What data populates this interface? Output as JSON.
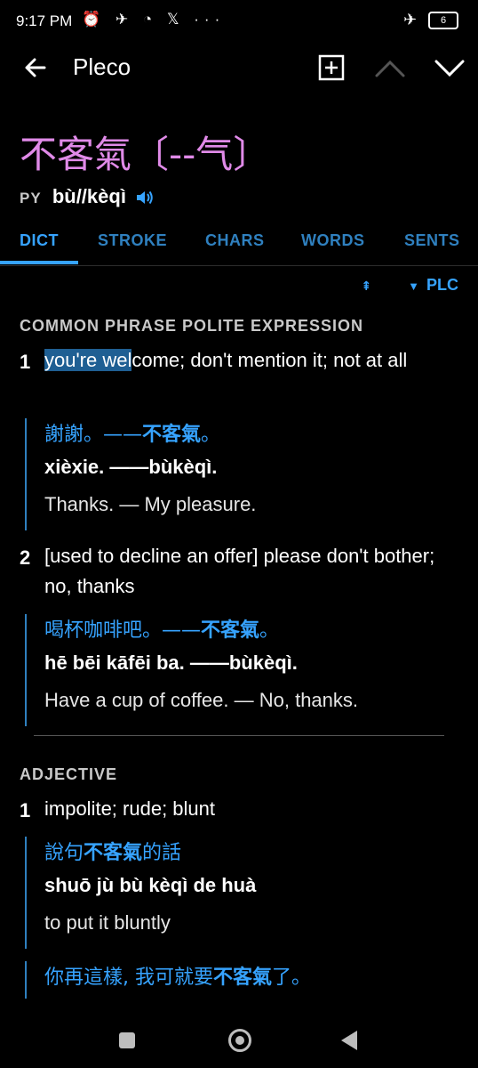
{
  "status": {
    "time": "9:17 PM",
    "icons": "⏰ ✈ ◔ 𝕏 ···",
    "battery": "6"
  },
  "appbar": {
    "title": "Pleco"
  },
  "entry": {
    "headword": "不客氣〔--气〕",
    "py_label": "PY",
    "reading": "bù//kèqì"
  },
  "tabs": [
    {
      "label": "DICT"
    },
    {
      "label": "STROKE"
    },
    {
      "label": "CHARS"
    },
    {
      "label": "WORDS"
    },
    {
      "label": "SENTS"
    }
  ],
  "dict_source": "PLC",
  "sections": {
    "s1_header": "COMMON PHRASE POLITE EXPRESSION",
    "d1_num": "1",
    "d1_hl": "you're wel",
    "d1_rest": "come; don't mention it; not at all",
    "ex1_cn_pre": "謝謝。——",
    "ex1_cn_bold": "不客氣",
    "ex1_cn_post": "。",
    "ex1_py": "xièxie. ——bùkèqì.",
    "ex1_en": "Thanks. — My pleasure.",
    "d2_num": "2",
    "d2_text": "[used to decline an offer] please don't bother; no, thanks",
    "ex2_cn_pre": "喝杯咖啡吧。——",
    "ex2_cn_bold": "不客氣",
    "ex2_cn_post": "。",
    "ex2_py": "hē bēi kāfēi ba. ——bùkèqì.",
    "ex2_en": "Have a cup of coffee. — No, thanks.",
    "s2_header": "ADJECTIVE",
    "d3_num": "1",
    "d3_text": "impolite; rude; blunt",
    "ex3_cn_pre": "說句",
    "ex3_cn_bold": "不客氣",
    "ex3_cn_post": "的話",
    "ex3_py_pre": "shuō jù ",
    "ex3_py_bold": "bù kèqì",
    "ex3_py_post": " de huà",
    "ex3_en": "to put it bluntly",
    "ex4_cn_pre": "你再這樣, 我可就要",
    "ex4_cn_bold": "不客氣",
    "ex4_cn_post": "了。"
  },
  "colors": {
    "accent": "#36a3ff",
    "headword": "#e08ae8",
    "highlight": "#1f5f93"
  },
  "icons": [
    "back-arrow-icon",
    "add-box-icon",
    "chevron-up-icon",
    "chevron-down-icon",
    "speaker-icon",
    "sort-icon",
    "dropdown-triangle-icon"
  ]
}
